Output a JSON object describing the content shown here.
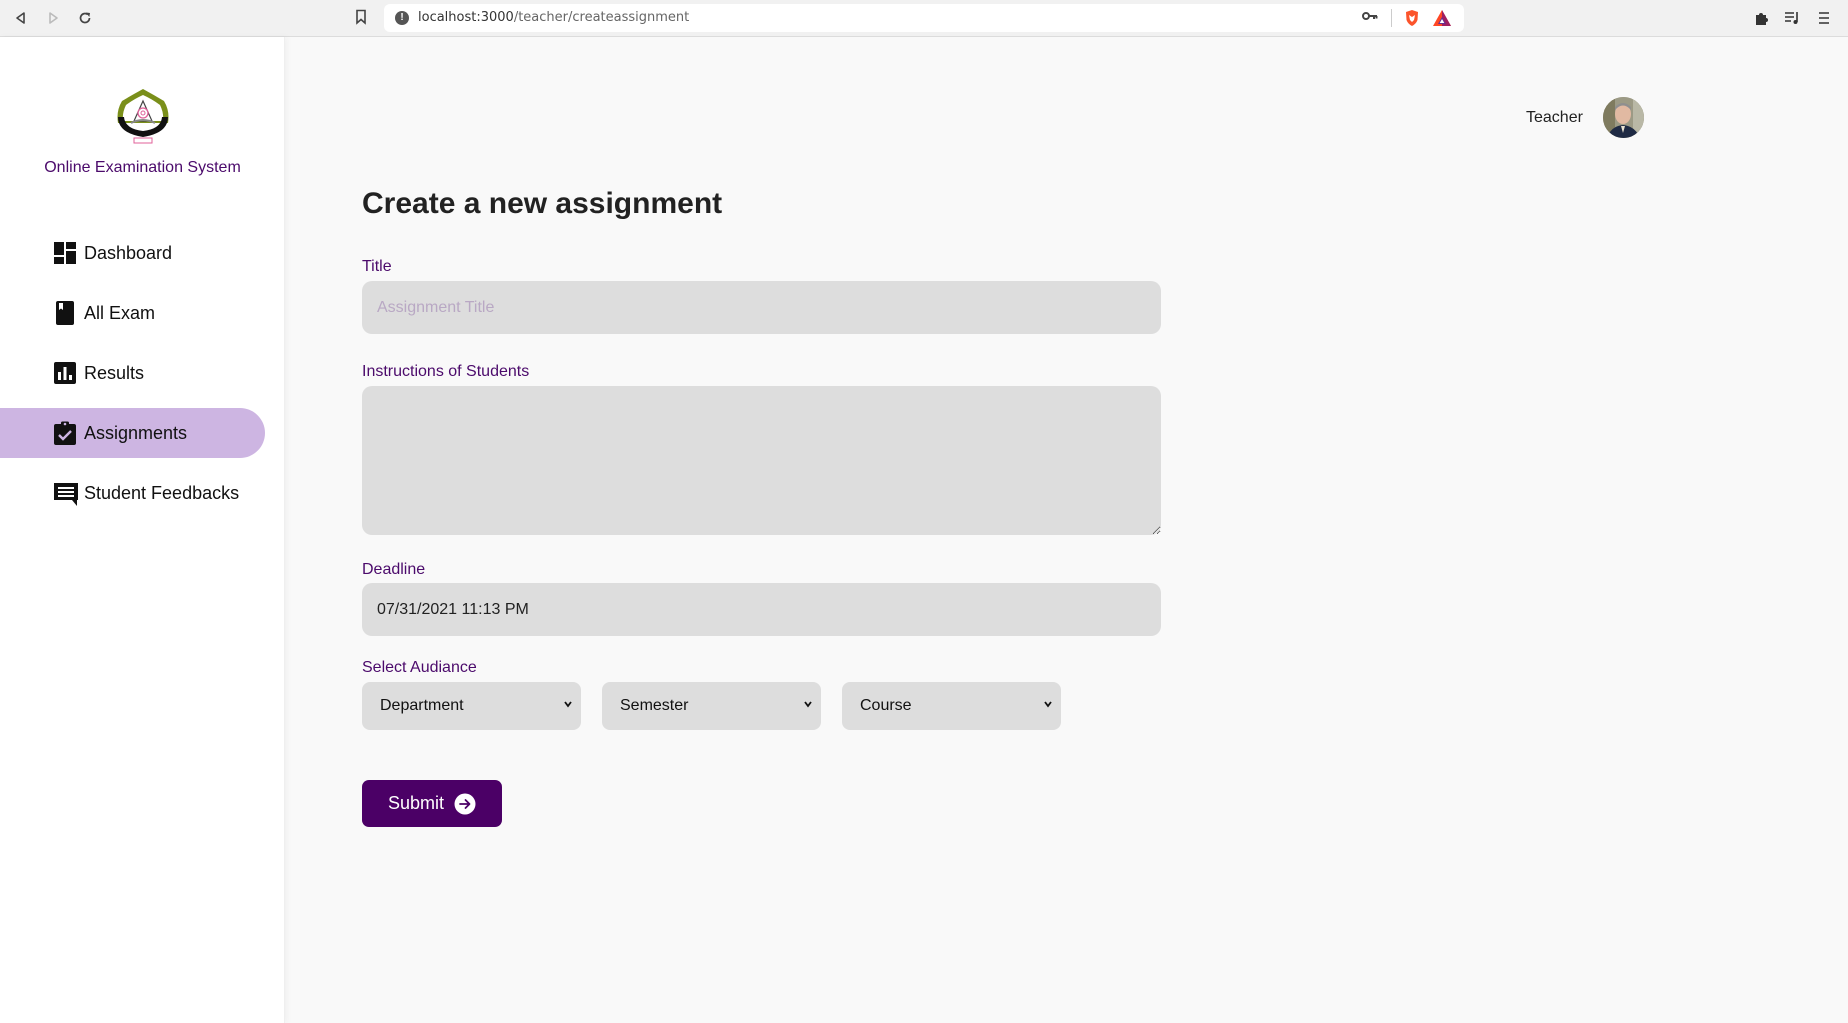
{
  "browser": {
    "url_host": "localhost:3000",
    "url_path": "/teacher/createassignment",
    "icons": [
      "back-icon",
      "forward-icon",
      "reload-icon",
      "bookmark-icon",
      "site-info-icon",
      "key-icon",
      "brave-shield-icon",
      "bat-rewards-icon",
      "extensions-icon",
      "media-playlist-icon",
      "menu-icon"
    ]
  },
  "sidebar": {
    "brand": "Online Examination System",
    "items": [
      {
        "label": "Dashboard",
        "icon": "dashboard-icon",
        "active": false
      },
      {
        "label": "All Exam",
        "icon": "book-icon",
        "active": false
      },
      {
        "label": "Results",
        "icon": "bar-chart-icon",
        "active": false
      },
      {
        "label": "Assignments",
        "icon": "clipboard-check-icon",
        "active": true
      },
      {
        "label": "Student Feedbacks",
        "icon": "feedback-icon",
        "active": false
      }
    ]
  },
  "header": {
    "user_role": "Teacher"
  },
  "form": {
    "heading": "Create a new assignment",
    "title_label": "Title",
    "title_placeholder": "Assignment Title",
    "title_value": "",
    "instructions_label": "Instructions of Students",
    "instructions_value": "",
    "deadline_label": "Deadline",
    "deadline_value": "07/31/2021 11:13 PM",
    "audience_label": "Select Audiance",
    "department_selected": "Department",
    "semester_selected": "Semester",
    "course_selected": "Course",
    "submit_label": "Submit"
  },
  "colors": {
    "accent": "#4b0066",
    "label": "#4b0a6b",
    "active_nav": "#cdb5e2",
    "input_bg": "#dddddd"
  }
}
